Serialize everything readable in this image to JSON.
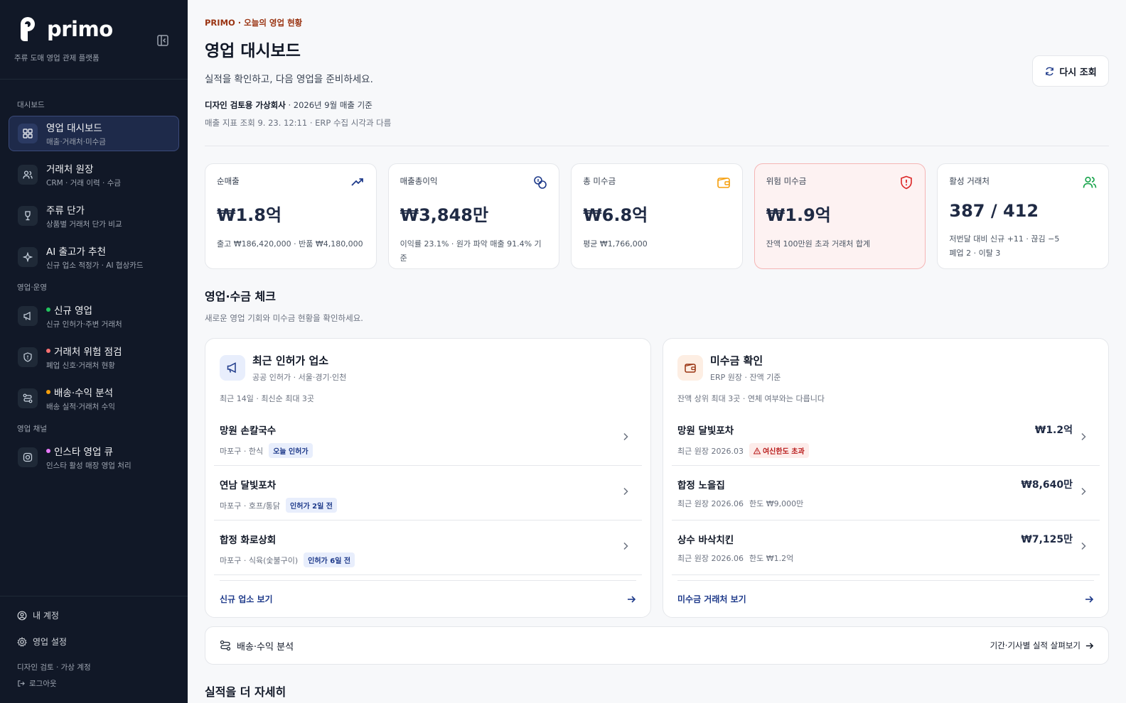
{
  "brand": {
    "name": "primo",
    "tagline": "주류 도매 영업 관제 플랫폼"
  },
  "sidebar": {
    "sections": [
      "대시보드",
      "영업·운영",
      "영업 채널"
    ],
    "items": [
      {
        "label": "영업 대시보드",
        "desc": "매출·거래처·미수금",
        "icon": "grid-icon"
      },
      {
        "label": "거래처 원장",
        "desc": "CRM · 거래 이력 · 수금",
        "icon": "users-icon"
      },
      {
        "label": "주류 단가",
        "desc": "상품별 거래처 단가 비교",
        "icon": "wine-icon"
      },
      {
        "label": "AI 출고가 추천",
        "desc": "신규 업소 적정가 · AI 협상카드",
        "icon": "sparkle-icon"
      },
      {
        "label": "신규 영업",
        "desc": "신규 인허가·주변 거래처",
        "icon": "megaphone-icon",
        "dot": "#22c55e"
      },
      {
        "label": "거래처 위험 점검",
        "desc": "폐업 신호·거래처 현황",
        "icon": "shield-icon",
        "dot": "#f87171"
      },
      {
        "label": "배송·수익 분석",
        "desc": "배송 실적·거래처 수익",
        "icon": "route-icon",
        "dot": "#f59e0b"
      },
      {
        "label": "인스타 영업 큐",
        "desc": "인스타 활성 매장 영업 처리",
        "icon": "instagram-icon",
        "dot": "#e879f9"
      }
    ],
    "account": "내 계정",
    "settings": "영업 설정",
    "note": "디자인 검토 · 가상 계정",
    "logout": "로그아웃"
  },
  "header": {
    "eyebrow": "PRIMO · 오늘의 영업 현황",
    "title": "영업 대시보드",
    "subtitle": "실적을 확인하고, 다음 영업을 준비하세요.",
    "company": "디자인 검토용 가상회사",
    "period": " · 2026년 9월 매출 기준",
    "refresh_note": "매출 지표 조회 9. 23. 12:11 · ERP 수집 시각과 다름",
    "refresh_button": "다시 조회"
  },
  "kpis": [
    {
      "label": "순매출",
      "value": "₩1.8억",
      "note": "출고 ₩186,420,000 · 반품 ₩4,180,000",
      "icon": "trend-up-icon",
      "color": "#1e3a8a"
    },
    {
      "label": "매출총이익",
      "value": "₩3,848만",
      "note": "이익률 23.1% · 원가 파악 매출 91.4% 기준",
      "icon": "coins-icon",
      "color": "#1e3a8a"
    },
    {
      "label": "총 미수금",
      "value": "₩6.8억",
      "note": "평균 ₩1,766,000",
      "icon": "wallet-icon",
      "color": "#f59e0b"
    },
    {
      "label": "위험 미수금",
      "value": "₩1.9억",
      "note": "잔액 100만원 초과 거래처 합계",
      "icon": "alert-shield-icon",
      "color": "#dc2626"
    },
    {
      "label": "활성 거래처",
      "value": "387 / 412",
      "note": "저번달 대비 신규 +11 · 끊김 −5",
      "note2": "폐업 2 · 이탈 3",
      "icon": "users-icon",
      "color": "#16a34a"
    }
  ],
  "check_section": {
    "title": "영업·수금 체크",
    "subtitle": "새로운 영업 기회와 미수금 현황을 확인하세요."
  },
  "new_card": {
    "title": "최근 인허가 업소",
    "subtitle": "공공 인허가 · 서울·경기·인천",
    "note": "최근 14일 · 최신순 최대 3곳",
    "rows": [
      {
        "name": "망원 손칼국수",
        "meta": "마포구 · 한식",
        "tag": "오늘 인허가"
      },
      {
        "name": "연남 달빛포차",
        "meta": "마포구 · 호프/통닭",
        "tag": "인허가 2일 전"
      },
      {
        "name": "합정 화로상회",
        "meta": "마포구 · 식육(숯불구이)",
        "tag": "인허가 6일 전"
      }
    ],
    "footer": "신규 업소 보기"
  },
  "ar_card": {
    "title": "미수금 확인",
    "subtitle": "ERP 원장 · 잔액 기준",
    "note": "잔액 상위 최대 3곳 · 연체 여부와는 다릅니다",
    "rows": [
      {
        "name": "망원 달빛포차",
        "meta": "최근 원장 2026.03",
        "tag": "여신한도 초과",
        "amount": "₩1.2억"
      },
      {
        "name": "합정 노을집",
        "meta": "최근 원장 2026.06",
        "limit": "한도 ₩9,000만",
        "amount": "₩8,640만"
      },
      {
        "name": "상수 바삭치킨",
        "meta": "최근 원장 2026.06",
        "limit": "한도 ₩1.2억",
        "amount": "₩7,125만"
      }
    ],
    "footer": "미수금 거래처 보기"
  },
  "strip": {
    "label": "배송·수익 분석",
    "link": "기간·기사별 실적 살펴보기"
  },
  "bottom": {
    "title": "실적을 더 자세히"
  }
}
